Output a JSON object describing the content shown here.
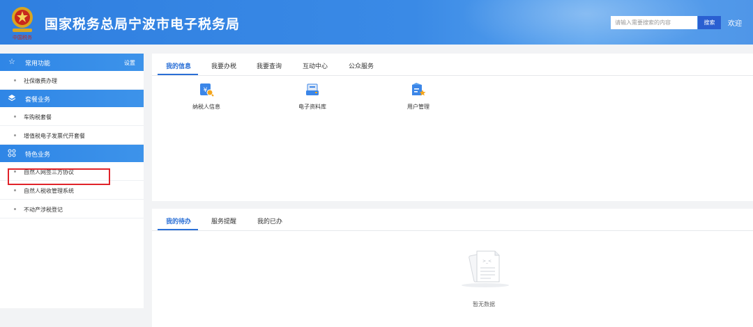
{
  "header": {
    "site_title": "国家税务总局宁波市电子税务局",
    "search_placeholder": "请输入需要搜索的内容",
    "search_button": "搜索",
    "welcome": "欢迎"
  },
  "sidebar": {
    "sections": [
      {
        "title": "常用功能",
        "icon": "star-icon",
        "extra": "设置",
        "items": [
          "社保缴费办理"
        ]
      },
      {
        "title": "套餐业务",
        "icon": "stack-icon",
        "items": [
          "车购税套餐",
          "增值税电子发票代开套餐"
        ]
      },
      {
        "title": "特色业务",
        "icon": "grid-icon",
        "items": [
          "自然人网签三方协议",
          "自然人税收管理系统",
          "不动产涉税登记"
        ]
      }
    ],
    "highlighted_item": "自然人网签三方协议"
  },
  "top_panel": {
    "tabs": [
      "我的信息",
      "我要办税",
      "我要查询",
      "互动中心",
      "公众服务"
    ],
    "active_tab": "我的信息",
    "apps": [
      {
        "label": "纳税人信息",
        "icon": "taxpayer-info-icon"
      },
      {
        "label": "电子资料库",
        "icon": "e-archive-icon"
      },
      {
        "label": "用户管理",
        "icon": "user-manage-icon"
      }
    ]
  },
  "bottom_panel": {
    "tabs": [
      "我的待办",
      "服务提醒",
      "我的已办"
    ],
    "active_tab": "我的待办",
    "empty_text": "暂无数据"
  },
  "colors": {
    "header_blue": "#3a8ae6",
    "sidebar_head": "#2f86e6",
    "active_tab": "#2a6fd6",
    "search_button": "#2a5fd1",
    "highlight_red": "#e0232a"
  }
}
